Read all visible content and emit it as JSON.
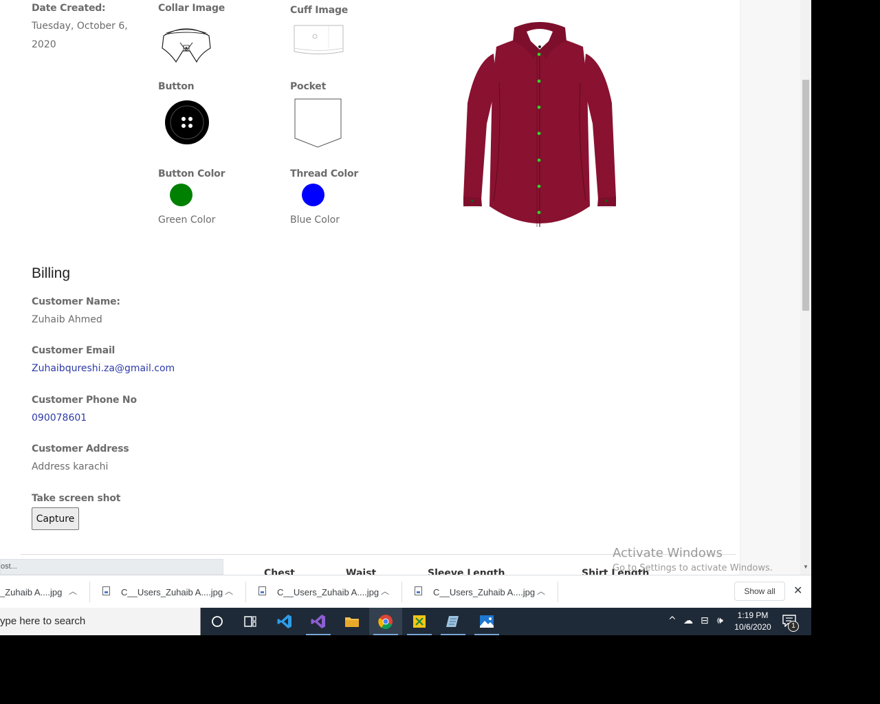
{
  "order": {
    "date_created_label": "Date Created:",
    "date_line1": "Tuesday, October 6,",
    "date_line2": "2020"
  },
  "design": {
    "collar_label": "Collar Image",
    "cuff_label": "Cuff Image",
    "button_label": "Button",
    "pocket_label": "Pocket",
    "button_color_label": "Button Color",
    "thread_color_label": "Thread Color",
    "button_color_name": "Green Color",
    "thread_color_name": "Blue Color",
    "button_color_hex": "#008000",
    "thread_color_hex": "#0000ff",
    "shirt_color_hex": "#8e1232"
  },
  "billing": {
    "heading": "Billing",
    "name_label": "Customer Name:",
    "name": "Zuhaib Ahmed",
    "email_label": "Customer Email",
    "email": "Zuhaibqureshi.za@gmail.com",
    "phone_label": "Customer Phone No",
    "phone": "090078601",
    "address_label": "Customer Address",
    "address": "Address karachi",
    "screenshot_label": "Take screen shot",
    "capture_button": "Capture"
  },
  "below": {
    "sidebar_stub": "ost...",
    "columns": [
      "Chest",
      "Waist",
      "Sleeve Length",
      "Shirt Length"
    ]
  },
  "watermark": {
    "title": "Activate Windows",
    "subtitle": "Go to Settings to activate Windows."
  },
  "downloads": {
    "items": [
      "_Zuhaib A....jpg",
      "C__Users_Zuhaib A....jpg",
      "C__Users_Zuhaib A....jpg",
      "C__Users_Zuhaib A....jpg"
    ],
    "show_all": "Show all"
  },
  "taskbar": {
    "search_placeholder": "ype here to search",
    "time": "1:19 PM",
    "date": "10/6/2020",
    "notification_count": "1"
  }
}
